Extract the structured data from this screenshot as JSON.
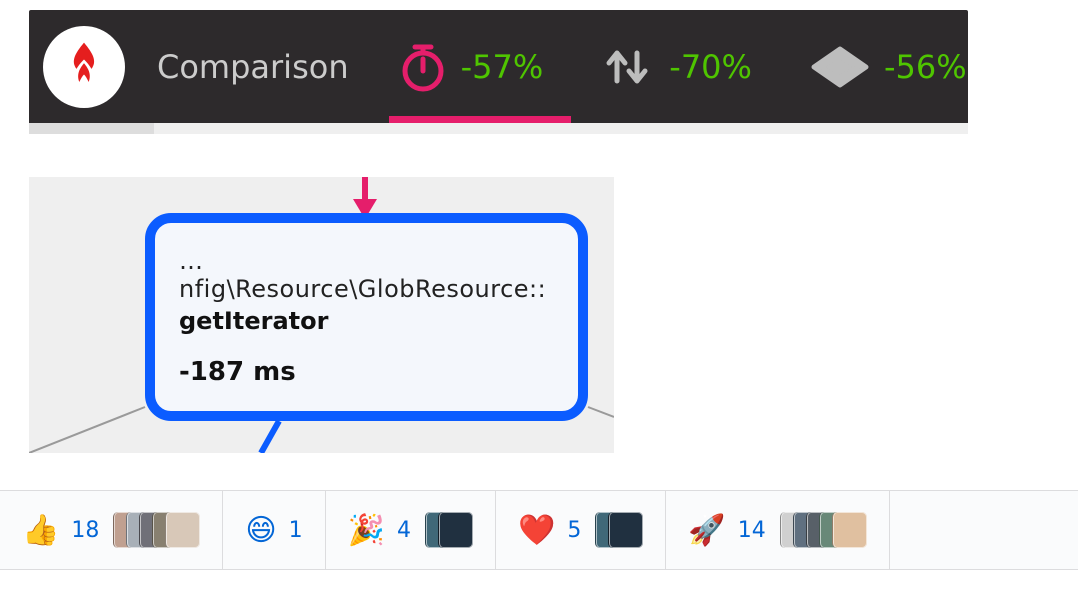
{
  "profiler": {
    "title": "Comparison",
    "metrics": {
      "time": {
        "value": "-57%",
        "icon": "stopwatch-icon",
        "active": true
      },
      "io": {
        "value": "-70%",
        "icon": "io-icon",
        "active": false
      },
      "memory": {
        "value": "-56%",
        "icon": "chip-icon",
        "active": false
      }
    }
  },
  "callgraph": {
    "node": {
      "path": "…nfig\\Resource\\GlobResource::",
      "method": "getIterator",
      "delta": "-187 ms"
    }
  },
  "reactions": [
    {
      "emoji": "👍",
      "name": "thumbs-up",
      "count": 18,
      "avatars": 5
    },
    {
      "emoji": "😄",
      "name": "laugh",
      "count": 1,
      "avatars": 0
    },
    {
      "emoji": "🎉",
      "name": "hooray",
      "count": 4,
      "avatars": 2
    },
    {
      "emoji": "❤️",
      "name": "heart",
      "count": 5,
      "avatars": 2
    },
    {
      "emoji": "🚀",
      "name": "rocket",
      "count": 14,
      "avatars": 5
    }
  ]
}
